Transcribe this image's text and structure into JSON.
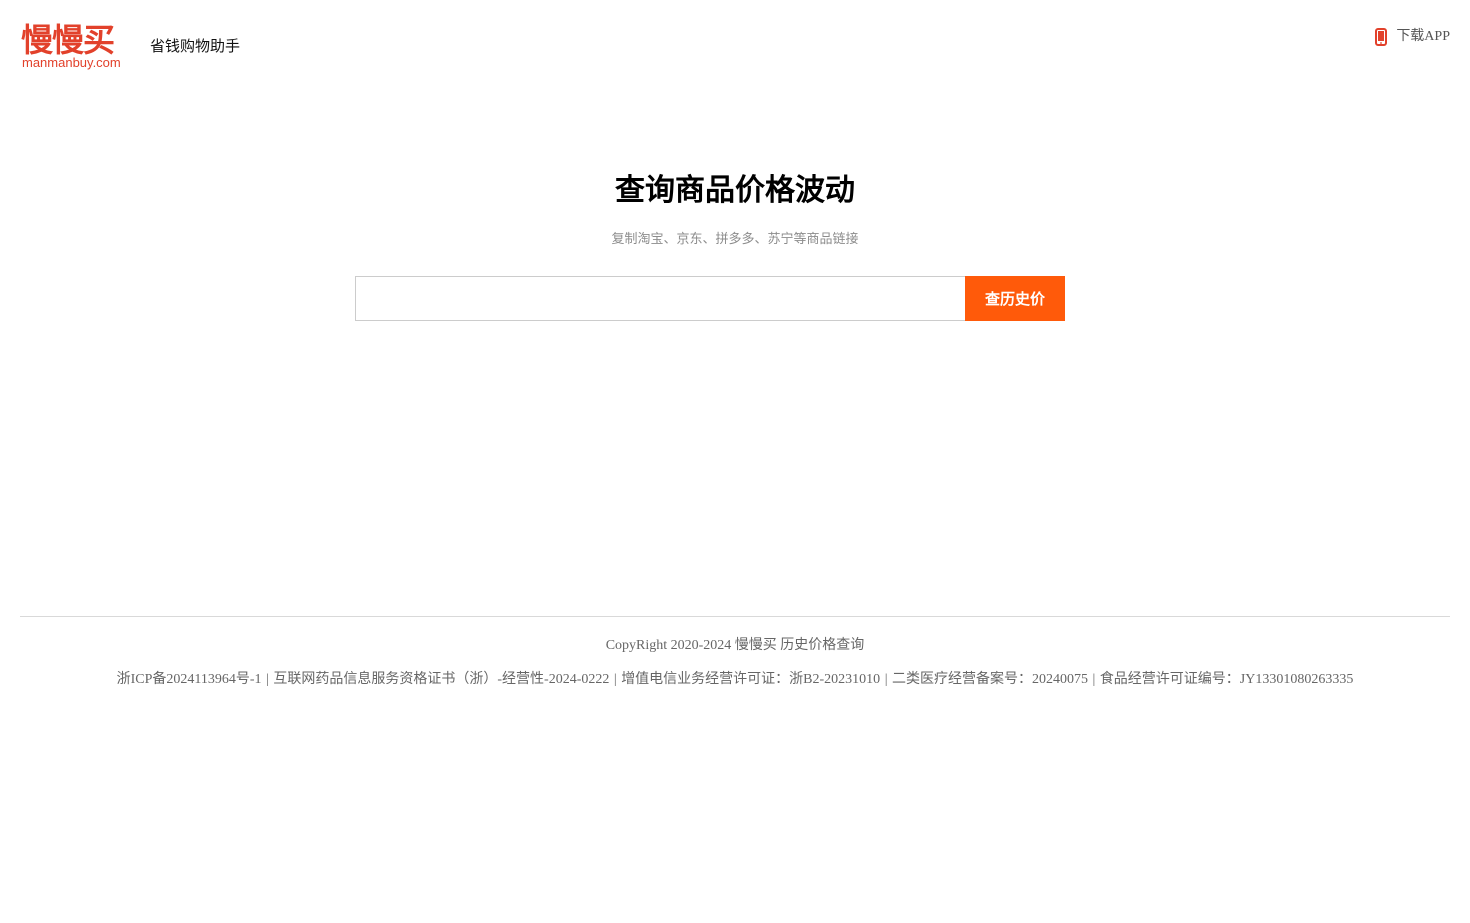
{
  "brand": {
    "logo_cn": "慢慢买",
    "logo_en": "manmanbuy.com",
    "tagline": "省钱购物助手",
    "color": "#e2412b"
  },
  "header": {
    "download_label": "下载APP",
    "download_icon": "phone-icon"
  },
  "main": {
    "title": "查询商品价格波动",
    "subtitle": "复制淘宝、京东、拼多多、苏宁等商品链接",
    "search": {
      "value": "",
      "placeholder": ""
    },
    "search_button_label": "查历史价",
    "accent_color": "#ff5a0a"
  },
  "footer": {
    "copyright": "CopyRight 2020-2024 慢慢买 历史价格查询",
    "licenses": [
      "浙ICP备2024113964号-1",
      "互联网药品信息服务资格证书（浙）-经营性-2024-0222",
      "增值电信业务经营许可证：浙B2-20231010",
      "二类医疗经营备案号：20240075",
      "食品经营许可证编号：JY13301080263335"
    ],
    "separator": "|"
  }
}
